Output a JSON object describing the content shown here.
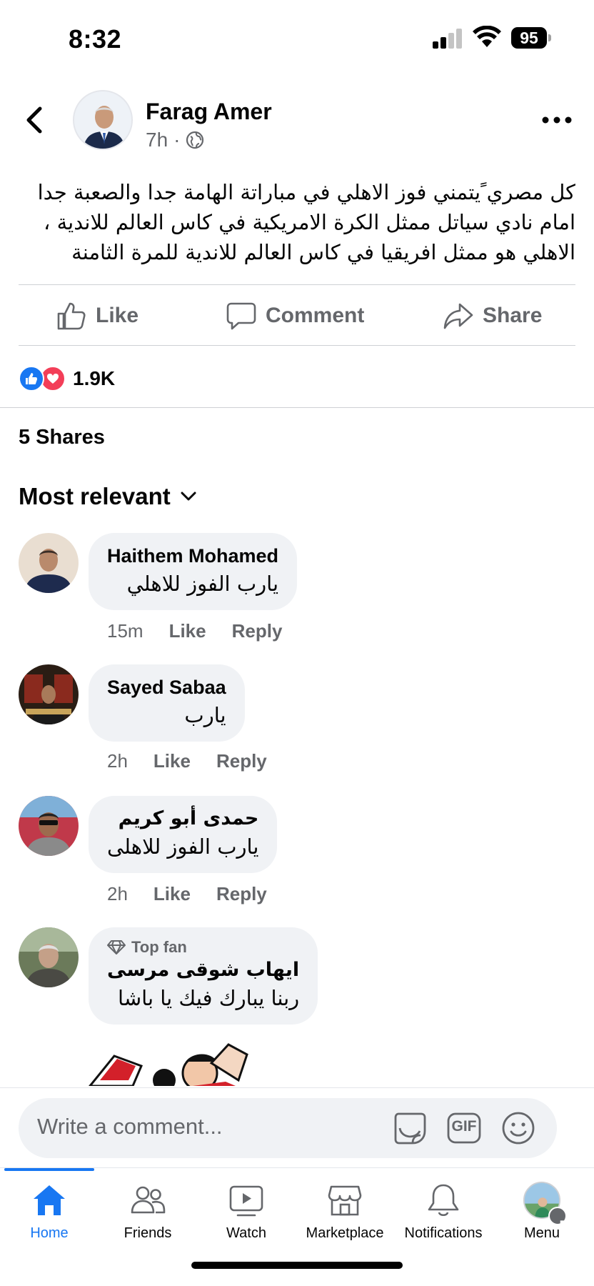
{
  "status_bar": {
    "time": "8:32",
    "battery": "95"
  },
  "post": {
    "author": "Farag Amer",
    "time": "7h",
    "meta_separator": "·",
    "text_lines": [
      "كل مصري ًيتمني فوز الاهلي  في مباراتة الهامة جدا والصعبة جدا",
      "امام نادي سياتل ممثل الكرة الامريكية في كاس العالم للاندية ،",
      "الاهلي هو ممثل افريقيا  في كاس العالم للاندية للمرة الثامنة"
    ]
  },
  "actions": {
    "like": "Like",
    "comment": "Comment",
    "share": "Share"
  },
  "reactions": {
    "count": "1.9K"
  },
  "shares": "5 Shares",
  "sort": {
    "label": "Most relevant"
  },
  "comments": [
    {
      "name": "Haithem Mohamed",
      "text": "يارب الفوز للاهلي",
      "time": "15m",
      "like": "Like",
      "reply": "Reply"
    },
    {
      "name": "Sayed Sabaa",
      "text": "يارب",
      "time": "2h",
      "like": "Like",
      "reply": "Reply"
    },
    {
      "name": "حمدى أبو كريم",
      "text": "يارب الفوز للاهلى",
      "time": "2h",
      "like": "Like",
      "reply": "Reply"
    },
    {
      "badge": "Top fan",
      "name": "ايهاب شوقى مرسى",
      "text": "ربنا يبارك فيك يا باشا"
    }
  ],
  "composer": {
    "placeholder": "Write a comment...",
    "gif_label": "GIF"
  },
  "nav": {
    "home": "Home",
    "friends": "Friends",
    "watch": "Watch",
    "marketplace": "Marketplace",
    "notifications": "Notifications",
    "menu": "Menu"
  },
  "colors": {
    "brand": "#1877f2",
    "love": "#f33e58",
    "secondary_text": "#65676b",
    "bubble": "#f0f2f5"
  },
  "icons": [
    "back-arrow-icon",
    "globe-icon",
    "more-dots-icon",
    "thumbs-up-icon",
    "speech-bubble-icon",
    "share-arrow-icon",
    "chevron-down-icon",
    "diamond-icon",
    "sticker-icon",
    "gif-icon",
    "smiley-icon",
    "home-icon",
    "friends-icon",
    "watch-icon",
    "marketplace-icon",
    "bell-icon"
  ]
}
